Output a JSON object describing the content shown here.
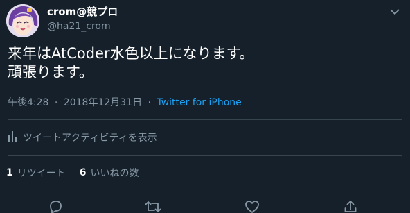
{
  "user": {
    "display_name": "crom@競プロ",
    "handle": "@ha21_crom"
  },
  "tweet": {
    "text": "来年はAtCoder水色以上になります。\n頑張ります。",
    "time": "午後4:28",
    "separator": "·",
    "date": "2018年12月31日",
    "source": "Twitter for iPhone"
  },
  "activity": {
    "label": "ツイートアクティビティを表示"
  },
  "stats": {
    "retweets_count": "1",
    "retweets_label": "リツイート",
    "likes_count": "6",
    "likes_label": "いいねの数"
  },
  "icons": {
    "caret": "chevron-down-icon",
    "activity": "bar-chart-icon",
    "reply": "reply-icon",
    "retweet": "retweet-icon",
    "like": "heart-icon",
    "share": "share-icon"
  },
  "colors": {
    "background": "#15202b",
    "secondary_text": "#8899a6",
    "link": "#1da1f2",
    "divider": "#38444d"
  }
}
